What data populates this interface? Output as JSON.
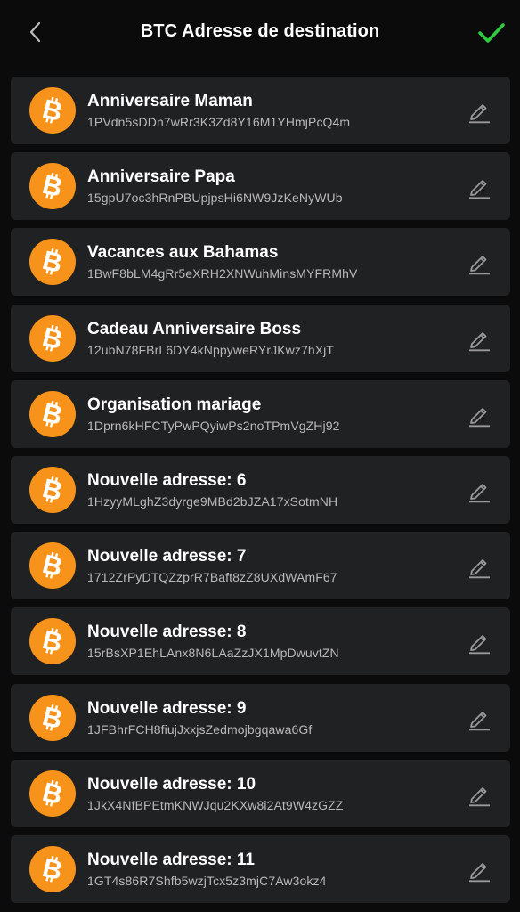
{
  "header": {
    "title": "BTC Adresse de destination",
    "back_icon": "chevron-left-icon",
    "confirm_icon": "check-icon",
    "confirm_color": "#2ecc40"
  },
  "colors": {
    "background": "#0b0b0c",
    "card": "#202123",
    "bitcoin": "#f7931a",
    "address_text": "#b9b9bb"
  },
  "addresses": [
    {
      "name": "Anniversaire Maman",
      "address": "1PVdn5sDDn7wRr3K3Zd8Y16M1YHmjPcQ4m"
    },
    {
      "name": "Anniversaire Papa",
      "address": "15gpU7oc3hRnPBUpjpsHi6NW9JzKeNyWUb"
    },
    {
      "name": "Vacances aux Bahamas",
      "address": "1BwF8bLM4gRr5eXRH2XNWuhMinsMYFRMhV"
    },
    {
      "name": "Cadeau Anniversaire Boss",
      "address": "12ubN78FBrL6DY4kNppyweRYrJKwz7hXjT"
    },
    {
      "name": "Organisation mariage",
      "address": "1Dprn6kHFCTyPwPQyiwPs2noTPmVgZHj92"
    },
    {
      "name": "Nouvelle adresse: 6",
      "address": "1HzyyMLghZ3dyrge9MBd2bJZA17xSotmNH"
    },
    {
      "name": "Nouvelle adresse: 7",
      "address": "1712ZrPyDTQZzprR7Baft8zZ8UXdWAmF67"
    },
    {
      "name": "Nouvelle adresse: 8",
      "address": "15rBsXP1EhLAnx8N6LAaZzJX1MpDwuvtZN"
    },
    {
      "name": "Nouvelle adresse: 9",
      "address": "1JFBhrFCH8fiujJxxjsZedmojbgqawa6Gf"
    },
    {
      "name": "Nouvelle adresse: 10",
      "address": "1JkX4NfBPEtmKNWJqu2KXw8i2At9W4zGZZ"
    },
    {
      "name": "Nouvelle adresse: 11",
      "address": "1GT4s86R7Shfb5wzjTcx5z3mjC7Aw3okz4"
    }
  ],
  "item_icons": {
    "coin": "bitcoin-icon",
    "edit": "pencil-icon"
  }
}
